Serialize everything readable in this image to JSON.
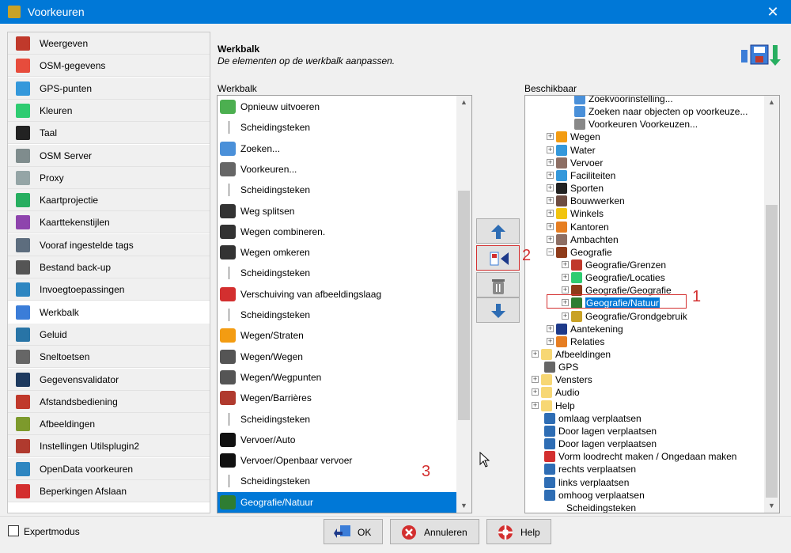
{
  "window": {
    "title": "Voorkeuren",
    "close_glyph": "✕"
  },
  "sidebar": {
    "items": [
      {
        "label": "Weergeven",
        "icon": "display-icon",
        "color": "#c0392b"
      },
      {
        "label": "OSM-gegevens",
        "icon": "osm-data-icon",
        "color": "#e74c3c"
      },
      {
        "label": "GPS-punten",
        "icon": "gps-icon",
        "color": "#3498db"
      },
      {
        "label": "Kleuren",
        "icon": "colors-icon",
        "color": "#2ecc71"
      },
      {
        "label": "Taal",
        "icon": "language-icon",
        "color": "#222222"
      },
      {
        "label": "OSM Server",
        "icon": "server-icon",
        "color": "#7f8c8d"
      },
      {
        "label": "Proxy",
        "icon": "proxy-icon",
        "color": "#95a5a6"
      },
      {
        "label": "Kaartprojectie",
        "icon": "map-projection-icon",
        "color": "#27ae60"
      },
      {
        "label": "Kaarttekenstijlen",
        "icon": "map-style-icon",
        "color": "#8e44ad"
      },
      {
        "label": "Vooraf ingestelde tags",
        "icon": "tags-icon",
        "color": "#5d6d7e"
      },
      {
        "label": "Bestand back-up",
        "icon": "backup-icon",
        "color": "#555555"
      },
      {
        "label": "Invoegtoepassingen",
        "icon": "plugin-icon",
        "color": "#2e86c1"
      },
      {
        "label": "Werkbalk",
        "icon": "toolbar-icon",
        "color": "#3b7dd8"
      },
      {
        "label": "Geluid",
        "icon": "sound-icon",
        "color": "#2874a6"
      },
      {
        "label": "Sneltoetsen",
        "icon": "shortcuts-icon",
        "color": "#666666"
      },
      {
        "label": "Gegevensvalidator",
        "icon": "validator-icon",
        "color": "#1e3a5f"
      },
      {
        "label": "Afstandsbediening",
        "icon": "remote-icon",
        "color": "#c0392b"
      },
      {
        "label": "Afbeeldingen",
        "icon": "images-icon",
        "color": "#7d9a2c"
      },
      {
        "label": "Instellingen Utilsplugin2",
        "icon": "tools-icon",
        "color": "#b03a2e"
      },
      {
        "label": "OpenData voorkeuren",
        "icon": "opendata-icon",
        "color": "#2e86c1"
      },
      {
        "label": "Beperkingen Afslaan",
        "icon": "turn-restriction-icon",
        "color": "#d32f2f"
      }
    ],
    "selected_index": 12
  },
  "header": {
    "title": "Werkbalk",
    "subtitle": "De elementen op de werkbalk aanpassen."
  },
  "toolbar_list": {
    "label": "Werkbalk",
    "items": [
      {
        "text": "Opnieuw uitvoeren",
        "icon": "redo-icon",
        "color": "#4caf50"
      },
      {
        "text": "Scheidingsteken",
        "icon": "separator"
      },
      {
        "text": "Zoeken...",
        "icon": "search-icon",
        "color": "#4a90d9"
      },
      {
        "text": "Voorkeuren...",
        "icon": "preferences-icon",
        "color": "#666666"
      },
      {
        "text": "Scheidingsteken",
        "icon": "separator"
      },
      {
        "text": "Weg splitsen",
        "icon": "split-way-icon",
        "color": "#333333"
      },
      {
        "text": "Wegen combineren.",
        "icon": "combine-way-icon",
        "color": "#333333"
      },
      {
        "text": "Wegen omkeren",
        "icon": "reverse-way-icon",
        "color": "#333333"
      },
      {
        "text": "Scheidingsteken",
        "icon": "separator"
      },
      {
        "text": "Verschuiving van afbeeldingslaag",
        "icon": "imagery-offset-icon",
        "color": "#d32f2f"
      },
      {
        "text": "Scheidingsteken",
        "icon": "separator"
      },
      {
        "text": "Wegen/Straten",
        "icon": "streets-icon",
        "color": "#f39c12"
      },
      {
        "text": "Wegen/Wegen",
        "icon": "roads-icon",
        "color": "#555555"
      },
      {
        "text": "Wegen/Wegpunten",
        "icon": "waypoints-icon",
        "color": "#555555"
      },
      {
        "text": "Wegen/Barrières",
        "icon": "barrier-icon",
        "color": "#b03a2e"
      },
      {
        "text": "Scheidingsteken",
        "icon": "separator"
      },
      {
        "text": "Vervoer/Auto",
        "icon": "car-icon",
        "color": "#111111"
      },
      {
        "text": "Vervoer/Openbaar vervoer",
        "icon": "bus-icon",
        "color": "#111111"
      },
      {
        "text": "Scheidingsteken",
        "icon": "separator"
      },
      {
        "text": "Geografie/Natuur",
        "icon": "nature-icon",
        "color": "#2e7d32"
      }
    ],
    "selected_index": 19
  },
  "mid_buttons": [
    {
      "name": "move-up-button",
      "icon": "arrow-up-icon"
    },
    {
      "name": "add-to-toolbar-button",
      "icon": "add-to-toolbar-icon"
    },
    {
      "name": "delete-button",
      "icon": "trash-icon"
    },
    {
      "name": "move-down-button",
      "icon": "arrow-down-icon"
    }
  ],
  "available": {
    "label": "Beschikbaar",
    "items": [
      {
        "text": "Zoekvoorinstelling...",
        "indent": 2,
        "expand": "",
        "icon": "search-preset-icon",
        "color": "#4a90d9"
      },
      {
        "text": "Zoeken naar objecten op voorkeuze...",
        "indent": 2,
        "expand": "",
        "icon": "search-objects-icon",
        "color": "#4a90d9"
      },
      {
        "text": "Voorkeuren Voorkeuzen...",
        "indent": 2,
        "expand": "",
        "icon": "preset-prefs-icon",
        "color": "#888888"
      },
      {
        "text": "Wegen",
        "indent": 1,
        "expand": "+",
        "icon": "roads-icon",
        "color": "#f39c12"
      },
      {
        "text": "Water",
        "indent": 1,
        "expand": "+",
        "icon": "water-icon",
        "color": "#3498db"
      },
      {
        "text": "Vervoer",
        "indent": 1,
        "expand": "+",
        "icon": "transport-icon",
        "color": "#8d6e63"
      },
      {
        "text": "Faciliteiten",
        "indent": 1,
        "expand": "+",
        "icon": "facilities-icon",
        "color": "#3498db"
      },
      {
        "text": "Sporten",
        "indent": 1,
        "expand": "+",
        "icon": "sports-icon",
        "color": "#222222"
      },
      {
        "text": "Bouwwerken",
        "indent": 1,
        "expand": "+",
        "icon": "buildings-icon",
        "color": "#6d4c41"
      },
      {
        "text": "Winkels",
        "indent": 1,
        "expand": "+",
        "icon": "shops-icon",
        "color": "#f1c40f"
      },
      {
        "text": "Kantoren",
        "indent": 1,
        "expand": "+",
        "icon": "offices-icon",
        "color": "#e67e22"
      },
      {
        "text": "Ambachten",
        "indent": 1,
        "expand": "+",
        "icon": "crafts-icon",
        "color": "#8d6e63"
      },
      {
        "text": "Geografie",
        "indent": 1,
        "expand": "−",
        "icon": "geography-icon",
        "color": "#8e3b1a"
      },
      {
        "text": "Geografie/Grenzen",
        "indent": 2,
        "expand": "+",
        "icon": "boundaries-icon",
        "color": "#c0392b"
      },
      {
        "text": "Geografie/Locaties",
        "indent": 2,
        "expand": "+",
        "icon": "locations-icon",
        "color": "#2ecc71"
      },
      {
        "text": "Geografie/Geografie",
        "indent": 2,
        "expand": "+",
        "icon": "geography-icon",
        "color": "#8e3b1a"
      },
      {
        "text": "Geografie/Natuur",
        "indent": 2,
        "expand": "+",
        "icon": "nature-icon",
        "color": "#2e7d32",
        "selected": true
      },
      {
        "text": "Geografie/Grondgebruik",
        "indent": 2,
        "expand": "+",
        "icon": "landuse-icon",
        "color": "#c9a227"
      },
      {
        "text": "Aantekening",
        "indent": 1,
        "expand": "+",
        "icon": "annotation-icon",
        "color": "#1e3a8a"
      },
      {
        "text": "Relaties",
        "indent": 1,
        "expand": "+",
        "icon": "relations-icon",
        "color": "#e67e22"
      },
      {
        "text": "Afbeeldingen",
        "indent": 0,
        "expand": "+",
        "icon": "folder-icon",
        "color": "#f7d774"
      },
      {
        "text": "GPS",
        "indent": 0,
        "expand": "",
        "icon": "gps-dot-icon",
        "color": "#666666"
      },
      {
        "text": "Vensters",
        "indent": 0,
        "expand": "+",
        "icon": "folder-icon",
        "color": "#f7d774"
      },
      {
        "text": "Audio",
        "indent": 0,
        "expand": "+",
        "icon": "folder-icon",
        "color": "#f7d774"
      },
      {
        "text": "Help",
        "indent": 0,
        "expand": "+",
        "icon": "folder-icon",
        "color": "#f7d774"
      },
      {
        "text": "omlaag verplaatsen",
        "indent": 0,
        "expand": "",
        "icon": "move-down-icon",
        "color": "#2e6db4"
      },
      {
        "text": "Door lagen verplaatsen",
        "indent": 0,
        "expand": "",
        "icon": "arrow-left-icon",
        "color": "#2e6db4"
      },
      {
        "text": "Door lagen verplaatsen",
        "indent": 0,
        "expand": "",
        "icon": "arrow-right-icon",
        "color": "#2e6db4"
      },
      {
        "text": "Vorm loodrecht maken / Ongedaan maken",
        "indent": 0,
        "expand": "",
        "icon": "orthogonal-icon",
        "color": "#d32f2f"
      },
      {
        "text": "rechts verplaatsen",
        "indent": 0,
        "expand": "",
        "icon": "move-right-icon",
        "color": "#2e6db4"
      },
      {
        "text": "links verplaatsen",
        "indent": 0,
        "expand": "",
        "icon": "move-left-icon",
        "color": "#2e6db4"
      },
      {
        "text": "omhoog verplaatsen",
        "indent": 0,
        "expand": "",
        "icon": "move-up-icon",
        "color": "#2e6db4"
      },
      {
        "text": "Scheidingsteken",
        "indent": 0,
        "expand": "",
        "icon": "separator"
      }
    ]
  },
  "annotations": {
    "one": "1",
    "two": "2",
    "three": "3"
  },
  "footer": {
    "expert_label": "Expertmodus",
    "ok_label": "OK",
    "cancel_label": "Annuleren",
    "help_label": "Help"
  },
  "colors": {
    "accent": "#0078d7",
    "annotation": "#d32f2f"
  }
}
